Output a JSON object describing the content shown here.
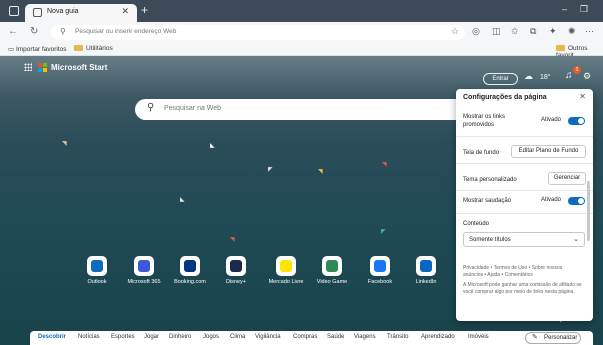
{
  "browser": {
    "tab_title": "Nova guia",
    "omnibox_placeholder": "Pesquisar ou inserir endereço Web",
    "favorites": [
      {
        "label": "Importar favoritos"
      },
      {
        "label": "Utilitários"
      }
    ],
    "other_favorites": "Outros favorit"
  },
  "header": {
    "brand": "Microsoft Start",
    "signin": "Entrar",
    "temperature": "18°",
    "notifications": "1"
  },
  "search": {
    "placeholder": "Pesquisar na Web"
  },
  "tiles": [
    {
      "label": "Outlook",
      "color": "#0f6cbd"
    },
    {
      "label": "Microsoft 365",
      "color": "#3b5bdb"
    },
    {
      "label": "Booking.com",
      "color": "#003580"
    },
    {
      "label": "Disney+",
      "color": "#1b2a4a"
    },
    {
      "label": "Mercado Livre",
      "color": "#ffe600"
    },
    {
      "label": "Video Game",
      "color": "#2e8b57"
    },
    {
      "label": "Facebook",
      "color": "#1877f2"
    },
    {
      "label": "LinkedIn",
      "color": "#0a66c2"
    }
  ],
  "settings": {
    "title": "Configurações da página",
    "promoted_links_label": "Mostrar os links promovidos",
    "promoted_links_state": "Ativado",
    "background_label": "Tela de fundo",
    "background_button": "Editar Plano de Fundo",
    "theme_label": "Tema personalizado",
    "theme_button": "Gerenciar",
    "greeting_label": "Mostrar saudação",
    "greeting_state": "Ativado",
    "content_label": "Conteúdo",
    "content_value": "Somente títulos",
    "footer_links": "Privacidade • Termos de Uso • Sobre nossos anúncios • Ajuda • Comentários",
    "disclaimer": "A Microsoft pode ganhar uma comissão de afiliado se você comprar algo por meio de links nesta página."
  },
  "bottom_nav": {
    "items": [
      "Descobrir",
      "Notícias",
      "Esportes",
      "Jogar",
      "Dinheiro",
      "Jogos",
      "Clima",
      "Vigilância",
      "Compras",
      "Saúde",
      "Viagens",
      "Trânsito",
      "Aprendizado",
      "Imóveis"
    ],
    "personalize": "Personalizar"
  },
  "colors": {
    "accent": "#0f6cbd",
    "titlebar": "#3c4b57"
  },
  "icons": [
    "apps-icon",
    "weather-icon",
    "bell-icon",
    "gear-icon",
    "search-icon",
    "pencil-icon"
  ]
}
